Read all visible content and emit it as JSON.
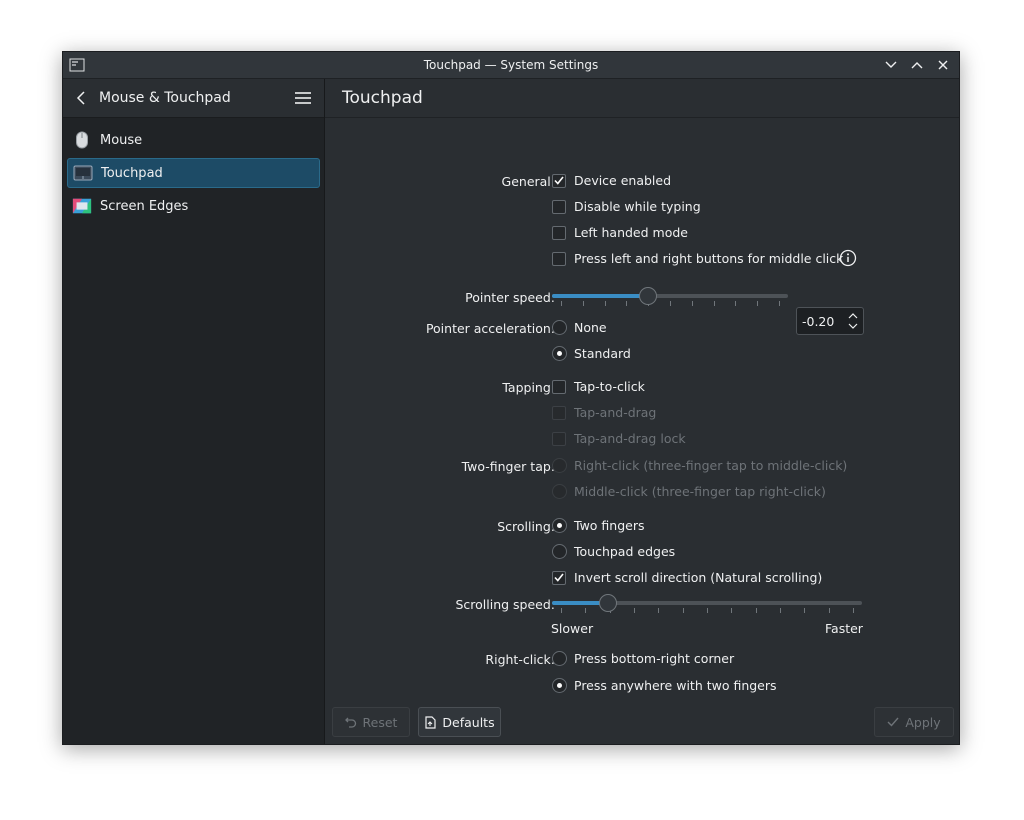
{
  "window": {
    "title": "Touchpad — System Settings"
  },
  "sidebar": {
    "header": "Mouse & Touchpad",
    "items": [
      {
        "label": "Mouse",
        "icon": "mouse-icon"
      },
      {
        "label": "Touchpad",
        "icon": "touchpad-icon",
        "active": true
      },
      {
        "label": "Screen Edges",
        "icon": "screen-edges-icon"
      }
    ]
  },
  "page": {
    "title": "Touchpad",
    "general": {
      "label": "General:",
      "device_enabled": "Device enabled",
      "disable_typing": "Disable while typing",
      "left_handed": "Left handed mode",
      "middle_click": "Press left and right buttons for middle click"
    },
    "pointer_speed": {
      "label": "Pointer speed:",
      "value": "-0.20",
      "fraction": 0.4
    },
    "pointer_accel": {
      "label": "Pointer acceleration:",
      "none": "None",
      "standard": "Standard",
      "selected": "standard"
    },
    "tapping": {
      "label": "Tapping:",
      "tap_to_click": "Tap-to-click",
      "tap_and_drag": "Tap-and-drag",
      "tap_and_drag_lock": "Tap-and-drag lock"
    },
    "two_finger_tap": {
      "label": "Two-finger tap:",
      "right_click": "Right-click (three-finger tap to middle-click)",
      "middle_click": "Middle-click (three-finger tap right-click)"
    },
    "scrolling": {
      "label": "Scrolling:",
      "two_fingers": "Two fingers",
      "touchpad_edges": "Touchpad edges",
      "invert": "Invert scroll direction (Natural scrolling)",
      "selected": "two_fingers"
    },
    "scrolling_speed": {
      "label": "Scrolling speed:",
      "min_label": "Slower",
      "max_label": "Faster",
      "fraction": 0.16
    },
    "right_click": {
      "label": "Right-click:",
      "bottom_right": "Press bottom-right corner",
      "two_fingers": "Press anywhere with two fingers",
      "selected": "two_fingers"
    }
  },
  "footer": {
    "reset": "Reset",
    "defaults": "Defaults",
    "apply": "Apply"
  },
  "colors": {
    "accent": "#3a8dc4",
    "selection": "#1d4b66",
    "background": "#2a2e32",
    "sidebar": "#202326"
  }
}
